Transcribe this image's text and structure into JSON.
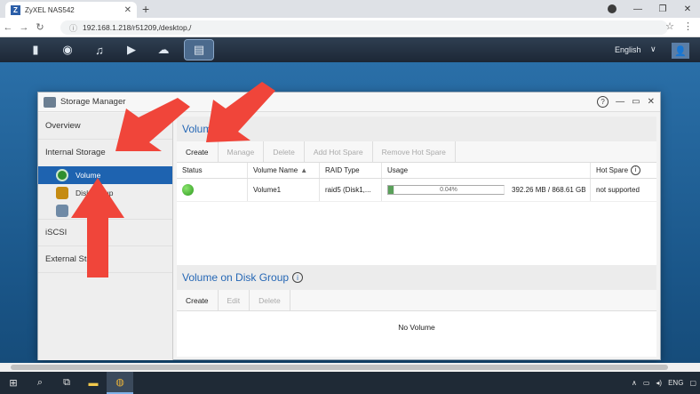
{
  "browser": {
    "tab_title": "ZyXEL NAS542",
    "favicon_letter": "Z",
    "address": "192.168.1.218/r51209,/desktop,/"
  },
  "nas": {
    "language": "English"
  },
  "window": {
    "title": "Storage Manager"
  },
  "sidebar": {
    "items": [
      {
        "label": "Overview"
      },
      {
        "label": "Internal Storage"
      },
      {
        "label": "iSCSI"
      },
      {
        "label": "External Storage"
      }
    ],
    "sub_items": [
      {
        "label": "Volume"
      },
      {
        "label": "Disk Group"
      },
      {
        "label": ""
      }
    ]
  },
  "volume_section": {
    "title": "Volume",
    "toolbar": {
      "create": "Create",
      "manage": "Manage",
      "delete": "Delete",
      "add_hot_spare": "Add Hot Spare",
      "remove_hot_spare": "Remove Hot Spare"
    },
    "columns": {
      "status": "Status",
      "volume_name": "Volume Name",
      "raid_type": "RAID Type",
      "usage": "Usage",
      "hot_spare": "Hot Spare"
    },
    "rows": [
      {
        "name": "Volume1",
        "raid": "raid5 (Disk1,...",
        "usage_percent_label": "0.04%",
        "usage_fraction": 0.0004,
        "usage_text": "392.26 MB / 868.61 GB",
        "hot_spare": "not supported"
      }
    ]
  },
  "disk_group_section": {
    "title": "Volume on Disk Group",
    "toolbar": {
      "create": "Create",
      "edit": "Edit",
      "delete": "Delete"
    },
    "empty_text": "No Volume"
  },
  "taskbar": {
    "tray_lang": "ENG"
  }
}
